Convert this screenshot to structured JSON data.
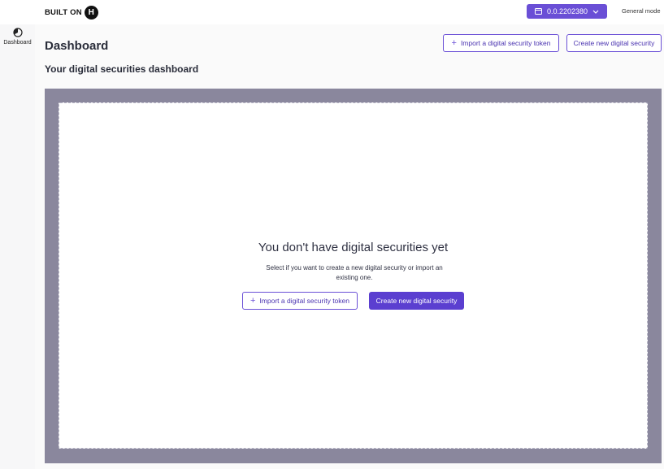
{
  "header": {
    "logo_text": "BUILT ON",
    "logo_badge": "H",
    "account_value": "0.0.2202380",
    "mode_label": "General mode"
  },
  "sidebar": {
    "items": [
      {
        "label": "Dashboard",
        "icon": "pie-chart-icon"
      }
    ]
  },
  "main": {
    "title": "Dashboard",
    "subtitle": "Your digital securities dashboard",
    "import_button": "Import a digital security token",
    "create_button": "Create new digital security"
  },
  "empty_state": {
    "title": "You don't have digital securities yet",
    "description": "Select if you want to create a new digital security or import an existing one.",
    "import_button": "Import a digital security token",
    "create_button": "Create new digital security"
  },
  "colors": {
    "accent": "#5b3fd0",
    "overlay": "#8a879d"
  }
}
